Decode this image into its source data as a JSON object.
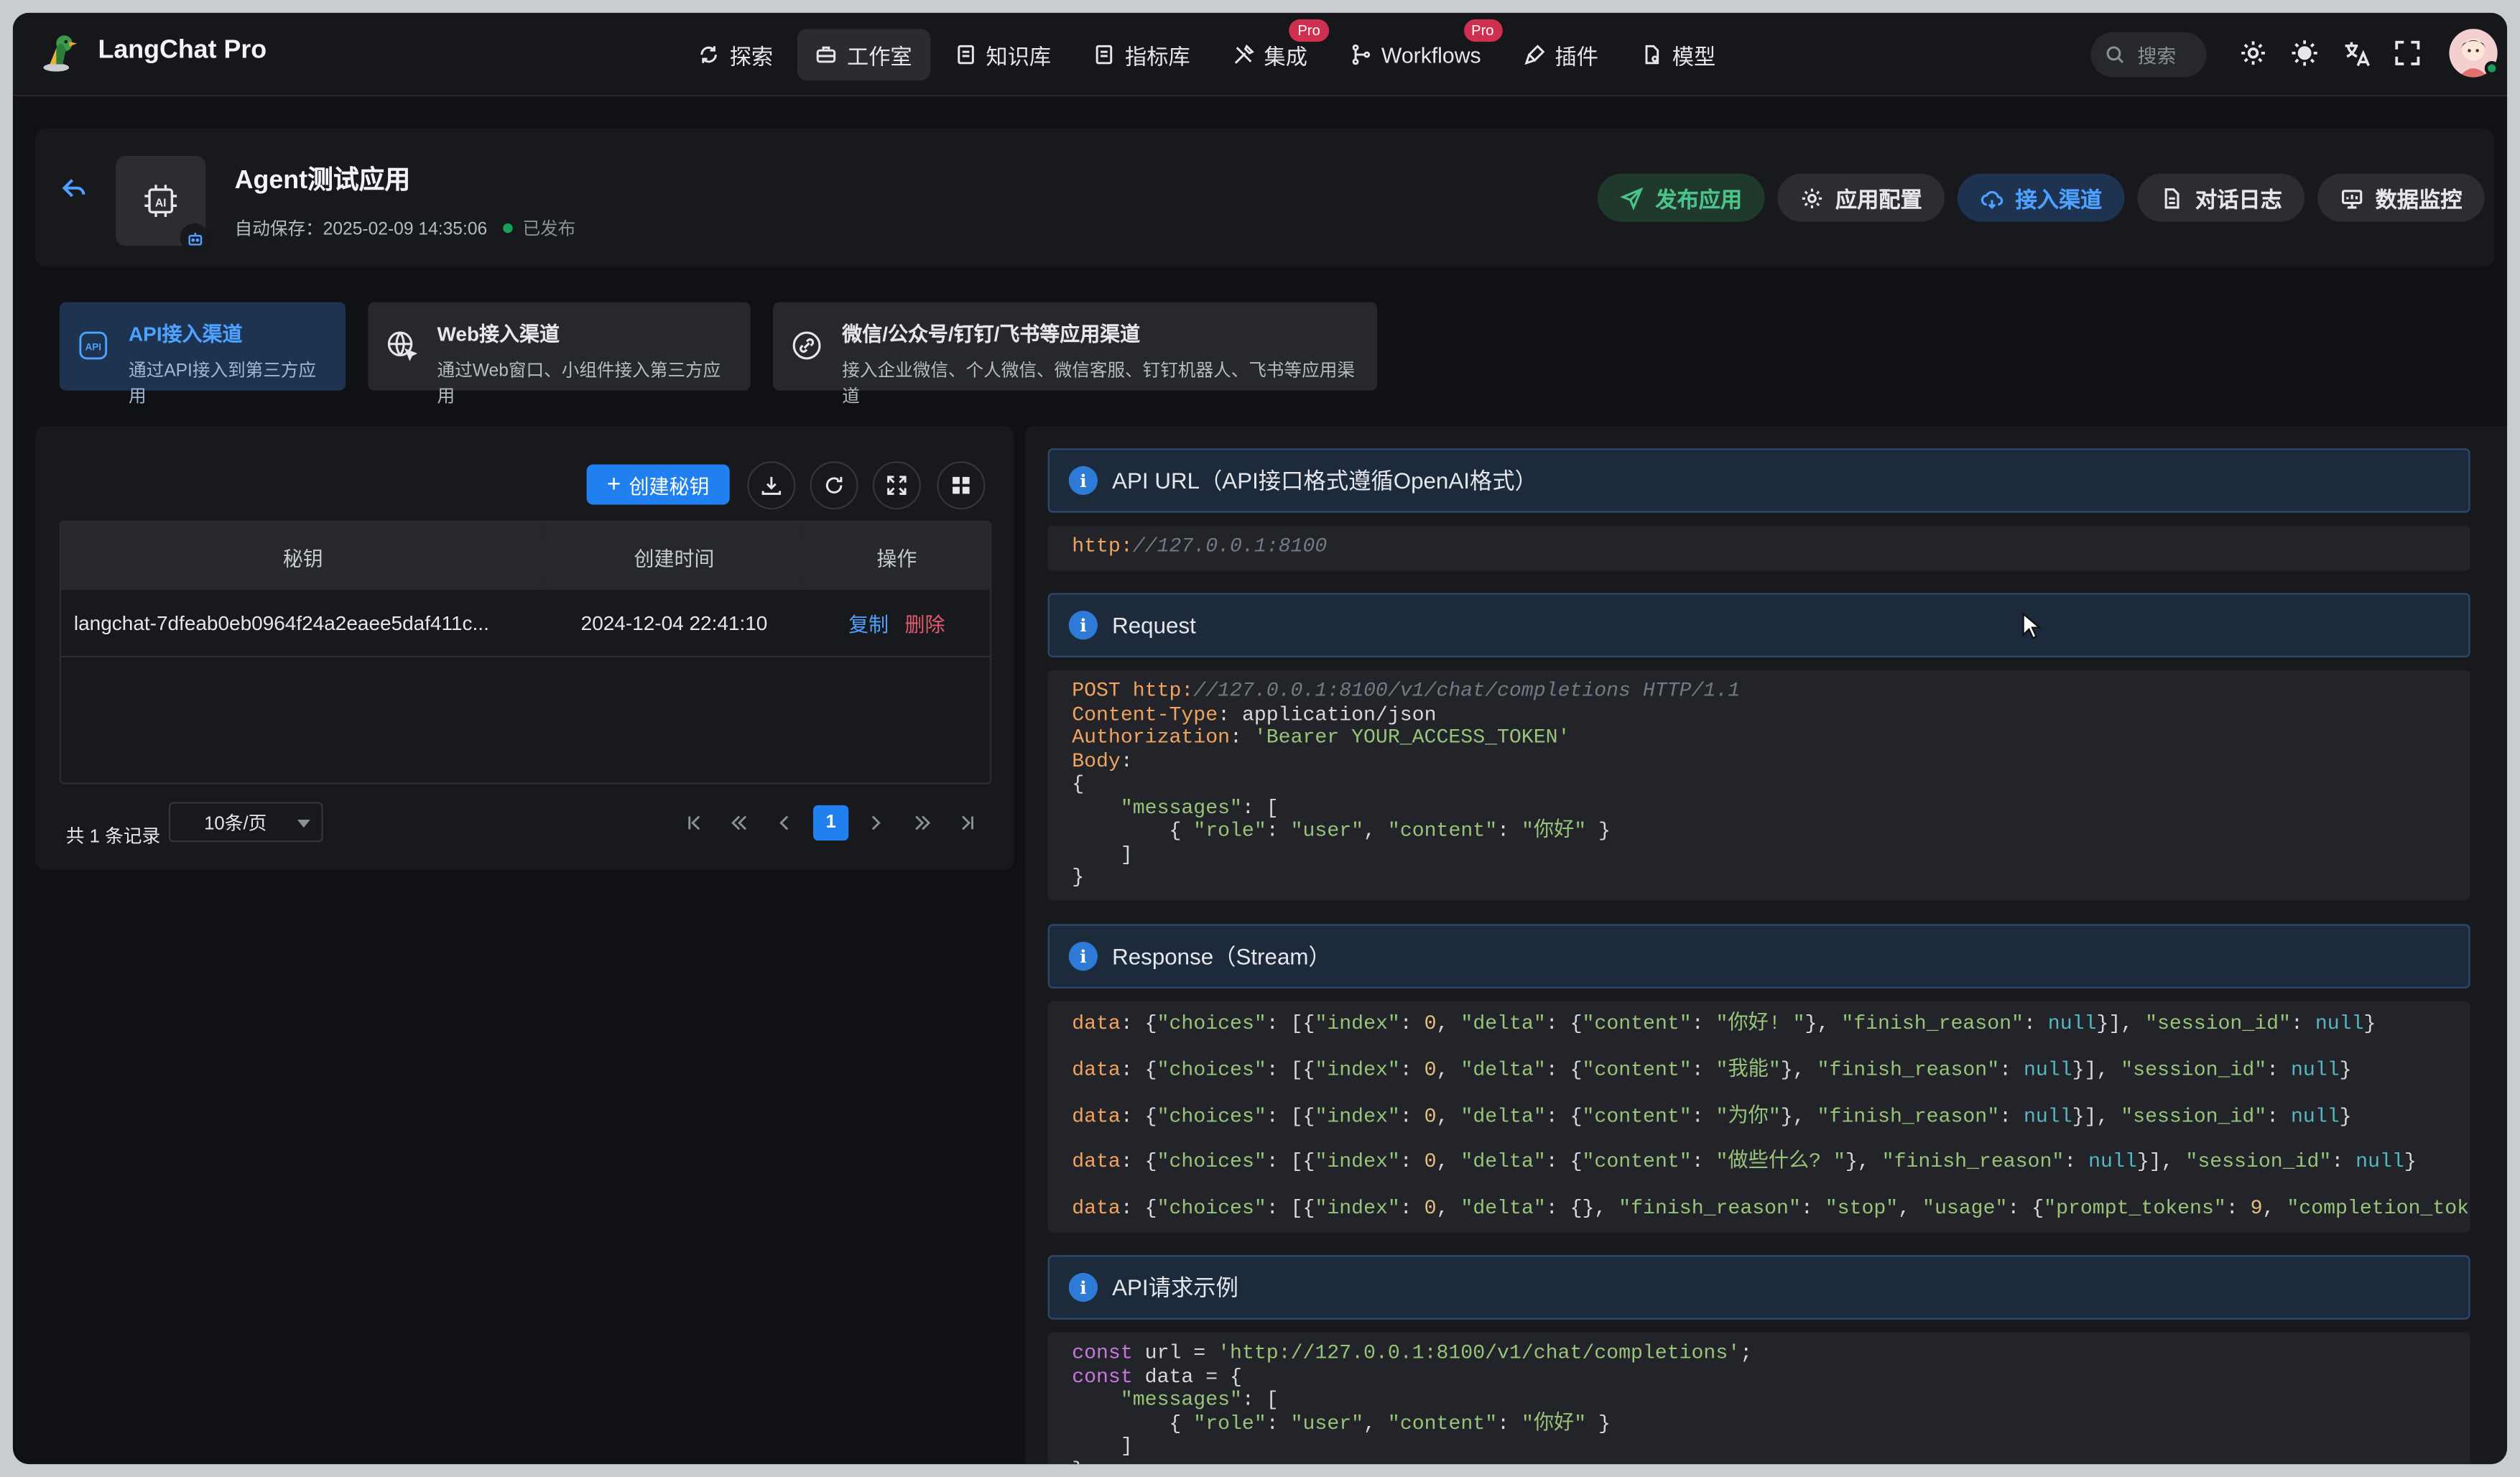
{
  "app": {
    "name": "LangChat Pro"
  },
  "nav": [
    {
      "label": "探索",
      "icon": "refresh-icon",
      "pro": false
    },
    {
      "label": "工作室",
      "icon": "briefcase-icon",
      "pro": false,
      "active": true
    },
    {
      "label": "知识库",
      "icon": "document-icon",
      "pro": false
    },
    {
      "label": "指标库",
      "icon": "document-icon",
      "pro": false
    },
    {
      "label": "集成",
      "icon": "tools-icon",
      "pro": true
    },
    {
      "label": "Workflows",
      "icon": "flow-icon",
      "pro": true
    },
    {
      "label": "插件",
      "icon": "plugin-icon",
      "pro": false
    },
    {
      "label": "模型",
      "icon": "file-icon",
      "pro": false
    }
  ],
  "pro_badge": "Pro",
  "search": {
    "placeholder": "搜索"
  },
  "header": {
    "title": "Agent测试应用",
    "autosave": "自动保存：2025-02-09 14:35:06",
    "status": "已发布",
    "buttons": {
      "publish": "发布应用",
      "config": "应用配置",
      "channel": "接入渠道",
      "logs": "对话日志",
      "monitor": "数据监控"
    }
  },
  "channels": [
    {
      "title": "API接入渠道",
      "subtitle": "通过API接入到第三方应用"
    },
    {
      "title": "Web接入渠道",
      "subtitle": "通过Web窗口、小组件接入第三方应用"
    },
    {
      "title": "微信/公众号/钉钉/飞书等应用渠道",
      "subtitle": "接入企业微信、个人微信、微信客服、钉钉机器人、飞书等应用渠道"
    }
  ],
  "keys": {
    "create_button": "创建秘钥",
    "columns": [
      "秘钥",
      "创建时间",
      "操作"
    ],
    "rows": [
      {
        "key": "langchat-7dfeab0eb0964f24a2eaee5daf411c...",
        "created": "2024-12-04 22:41:10",
        "copy": "复制",
        "delete": "删除"
      }
    ],
    "total": "共 1 条记录",
    "page_size": "10条/页",
    "current_page": "1"
  },
  "docs": {
    "api_url_title": "API URL（API接口格式遵循OpenAI格式）",
    "api_url_scheme": "http:",
    "api_url_rest": "//127.0.0.1:8100",
    "request_title": "Request",
    "response_title": "Response（Stream）",
    "example_title": "API请求示例"
  }
}
